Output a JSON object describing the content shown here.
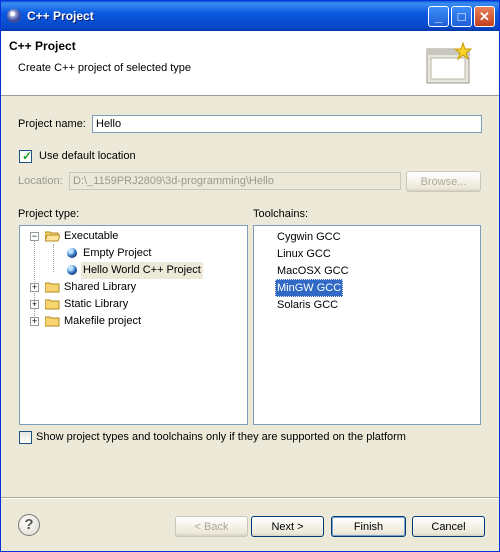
{
  "window": {
    "title": "C++ Project",
    "controls": {
      "minimize": "_",
      "maximize": "□",
      "close": "✕"
    }
  },
  "header": {
    "title": "C++ Project",
    "description": "Create C++ project of selected type",
    "banner_icon": "wizard-banner-icon"
  },
  "project_name": {
    "label": "Project name:",
    "value": "Hello"
  },
  "default_location": {
    "label": "Use default location",
    "checked": true
  },
  "location": {
    "label": "Location:",
    "value": "D:\\_1159PRJ2809\\3d-programming\\Hello",
    "browse_label": "Browse..."
  },
  "project_type": {
    "label": "Project type:",
    "items": [
      {
        "label": "Executable",
        "expanded": true,
        "children": [
          {
            "label": "Empty Project"
          },
          {
            "label": "Hello World C++ Project",
            "selected": true
          }
        ]
      },
      {
        "label": "Shared Library",
        "expanded": false
      },
      {
        "label": "Static Library",
        "expanded": false
      },
      {
        "label": "Makefile project",
        "expanded": false
      }
    ]
  },
  "toolchains": {
    "label": "Toolchains:",
    "items": [
      "Cygwin GCC",
      "Linux GCC",
      "MacOSX GCC",
      "MinGW GCC",
      "Solaris GCC"
    ],
    "selected": "MinGW GCC"
  },
  "platform_filter": {
    "label": "Show project types and toolchains only if they are supported on the platform",
    "checked": false
  },
  "buttons": {
    "back": "< Back",
    "next": "Next >",
    "finish": "Finish",
    "cancel": "Cancel"
  },
  "colors": {
    "title_bar": "#0a5ae0",
    "selection": "#316ac5",
    "dialog_bg": "#ece9d8"
  }
}
